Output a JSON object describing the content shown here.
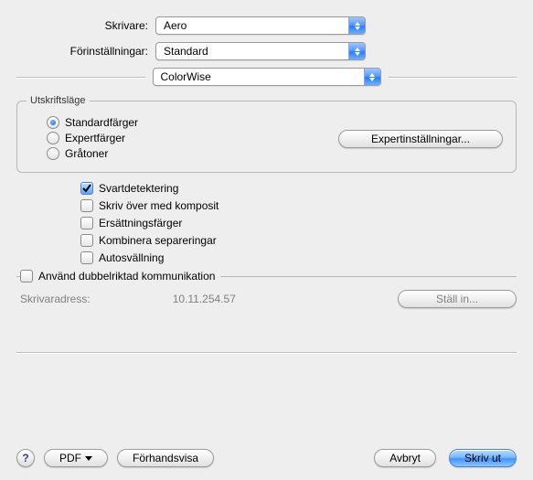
{
  "header": {
    "printer_label": "Skrivare:",
    "printer_value": "Aero",
    "presets_label": "Förinställningar:",
    "presets_value": "Standard",
    "pane_value": "ColorWise"
  },
  "mode": {
    "legend": "Utskriftsläge",
    "options": {
      "standard": "Standardfärger",
      "expert": "Expertfärger",
      "grayscale": "Gråtoner"
    },
    "selected": "standard",
    "expert_button": "Expertinställningar..."
  },
  "checks": {
    "black_detection": {
      "label": "Svartdetektering",
      "checked": true
    },
    "overwrite_composite": {
      "label": "Skriv över med komposit",
      "checked": false
    },
    "substitute_colors": {
      "label": "Ersättningsfärger",
      "checked": false
    },
    "combine_separations": {
      "label": "Kombinera separeringar",
      "checked": false
    },
    "auto_trapping": {
      "label": "Autosvällning",
      "checked": false
    }
  },
  "communication": {
    "use_bidirectional": {
      "label": "Använd dubbelriktad kommunikation",
      "checked": false
    },
    "address_label": "Skrivaradress:",
    "address_value": "10.11.254.57",
    "configure_button": "Ställ in..."
  },
  "footer": {
    "help": "?",
    "pdf": "PDF",
    "preview": "Förhandsvisa",
    "cancel": "Avbryt",
    "print": "Skriv ut"
  }
}
